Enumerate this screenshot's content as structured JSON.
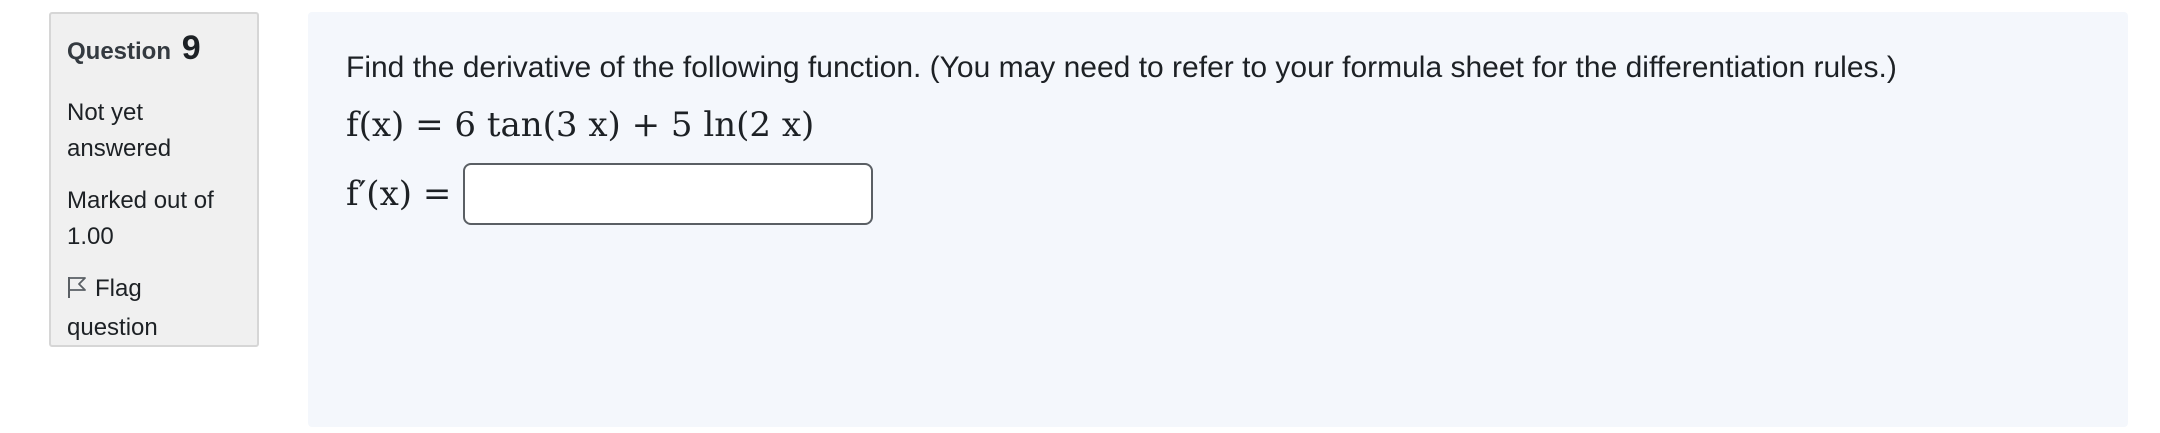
{
  "info": {
    "question_label": "Question",
    "question_number": "9",
    "state_line1": "Not yet",
    "state_line2": "answered",
    "grade_line1": "Marked out of",
    "grade_line2": "1.00",
    "flag_line1": "Flag",
    "flag_line2": "question",
    "flag_icon": "flag-outline-icon"
  },
  "question": {
    "prompt": "Find the derivative of the following function. (You may need to refer to your formula sheet for the differentiation rules.)",
    "formula": "f(x) = 6 tan(3 x) + 5 ln(2 x)",
    "answer_label": "f′(x) =",
    "answer_value": ""
  },
  "colors": {
    "info_bg": "#f0f0f0",
    "content_bg": "#f4f7fc",
    "text": "#1d2125"
  }
}
